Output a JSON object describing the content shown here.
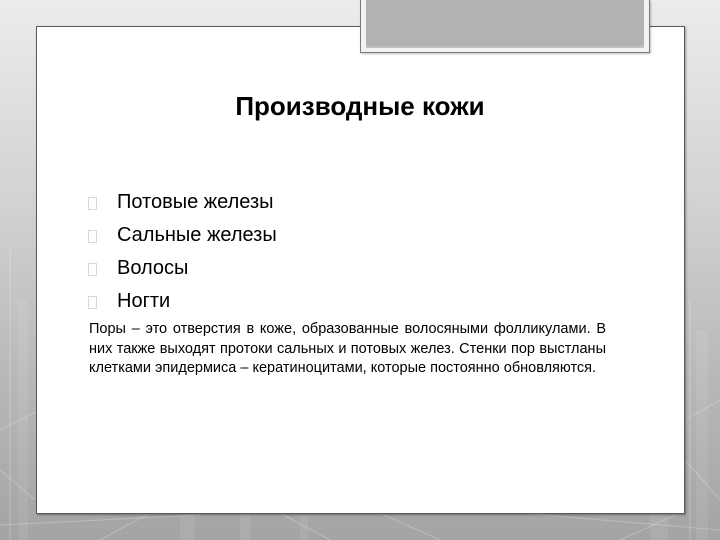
{
  "slide": {
    "title": "Производные кожи",
    "bullet_icon": "missing-glyph-box",
    "items": [
      {
        "label": "Потовые железы"
      },
      {
        "label": "Сальные железы"
      },
      {
        "label": "Волосы"
      },
      {
        "label": "Ногти"
      }
    ],
    "paragraph": "Поры – это отверстия в коже, образованные волосяными фолликулами. В них также выходят протоки сальных и потовых желез. Стенки пор выстланы клетками эпидермиса – кератиноцитами, которые постоянно обновляются."
  },
  "colors": {
    "panel": "#ffffff",
    "tab_fill": "#b2b2b2",
    "text": "#000000",
    "background_top": "#ececec",
    "background_bottom": "#a4a4a4"
  }
}
